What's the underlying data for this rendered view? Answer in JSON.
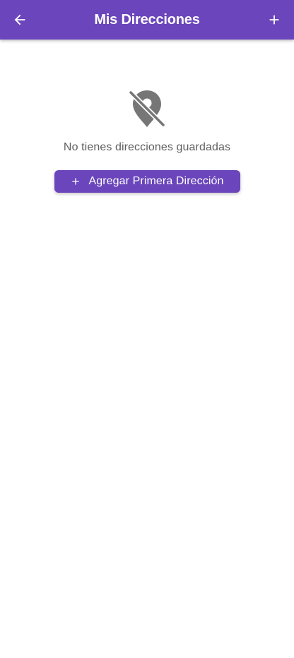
{
  "appbar": {
    "title": "Mis Direcciones",
    "back_icon": "arrow-back-icon",
    "add_icon": "add-icon",
    "color": "#6a45bb"
  },
  "empty_state": {
    "icon": "location-off-icon",
    "message": "No tienes direcciones guardadas",
    "button_label": "Agregar Primera Dirección",
    "button_icon": "add-icon"
  }
}
